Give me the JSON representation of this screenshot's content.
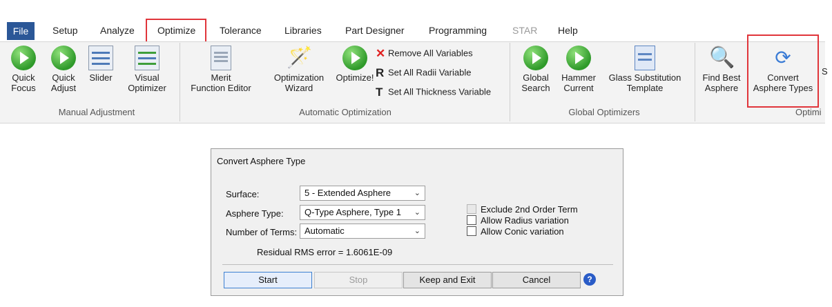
{
  "ribbon": {
    "tabs": [
      {
        "label": "File"
      },
      {
        "label": "Setup"
      },
      {
        "label": "Analyze"
      },
      {
        "label": "Optimize"
      },
      {
        "label": "Tolerance"
      },
      {
        "label": "Libraries"
      },
      {
        "label": "Part Designer"
      },
      {
        "label": "Programming"
      },
      {
        "label": "STAR"
      },
      {
        "label": "Help"
      }
    ],
    "groups": {
      "manual": {
        "label": "Manual Adjustment",
        "quick_focus": [
          "Quick",
          "Focus"
        ],
        "quick_adjust": [
          "Quick",
          "Adjust"
        ],
        "slider": "Slider",
        "visual_optimizer": [
          "Visual",
          "Optimizer"
        ]
      },
      "automatic": {
        "label": "Automatic Optimization",
        "merit_editor": [
          "Merit",
          "Function Editor"
        ],
        "opt_wizard": [
          "Optimization",
          "Wizard"
        ],
        "optimize": "Optimize!",
        "remove_all": "Remove All Variables",
        "set_radii": "Set All Radii Variable",
        "set_thickness": "Set All Thickness Variable"
      },
      "global": {
        "label": "Global Optimizers",
        "global_search": [
          "Global",
          "Search"
        ],
        "hammer_current": [
          "Hammer",
          "Current"
        ],
        "glass_sub": [
          "Glass Substitution",
          "Template"
        ]
      },
      "optim": {
        "label": "Optimi",
        "find_best": [
          "Find Best",
          "Asphere"
        ],
        "convert": [
          "Convert",
          "Asphere Types"
        ],
        "s_clip": "S"
      }
    }
  },
  "dialog": {
    "title": "Convert Asphere Type",
    "surface_label": "Surface:",
    "surface_value": "5 - Extended Asphere",
    "type_label": "Asphere Type:",
    "type_value": "Q-Type Asphere, Type 1",
    "terms_label": "Number of Terms:",
    "terms_value": "Automatic",
    "residual": "Residual RMS error = 1.6061E-09",
    "exclude_2nd": "Exclude 2nd Order Term",
    "allow_radius": "Allow Radius variation",
    "allow_conic": "Allow Conic variation",
    "buttons": {
      "start": "Start",
      "stop": "Stop",
      "keep_exit": "Keep and Exit",
      "cancel": "Cancel"
    },
    "help": "?"
  },
  "colors": {
    "file_tab": "#2b5797",
    "highlight": "#e0343a",
    "green_button": "#2f9a2a",
    "help": "#2a5cc7"
  }
}
